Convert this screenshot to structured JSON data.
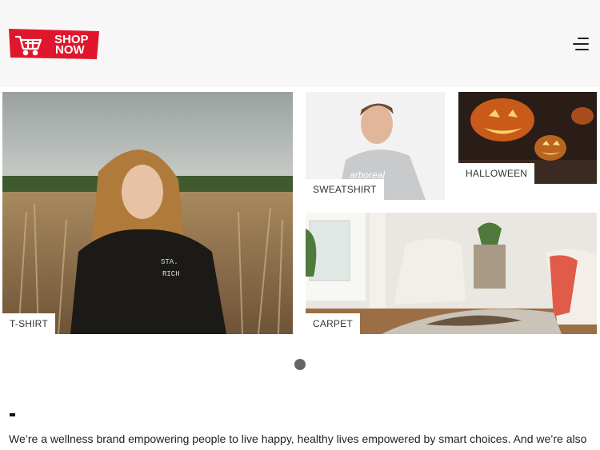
{
  "header": {
    "logo_text_top": "SHOP",
    "logo_text_bottom": "NOW",
    "logo_color": "#e0172c",
    "menu_icon": "hamburger-menu-icon"
  },
  "gallery": {
    "tiles": [
      {
        "label": "T-SHIRT"
      },
      {
        "label": "SWEATSHIRT"
      },
      {
        "label": "HALLOWEEN"
      },
      {
        "label": "CARPET"
      }
    ],
    "pagination": {
      "total": 1,
      "active": 1
    }
  },
  "about": {
    "text": "We’re a wellness brand empowering people to live happy, healthy lives empowered by smart choices. And we’re also"
  }
}
